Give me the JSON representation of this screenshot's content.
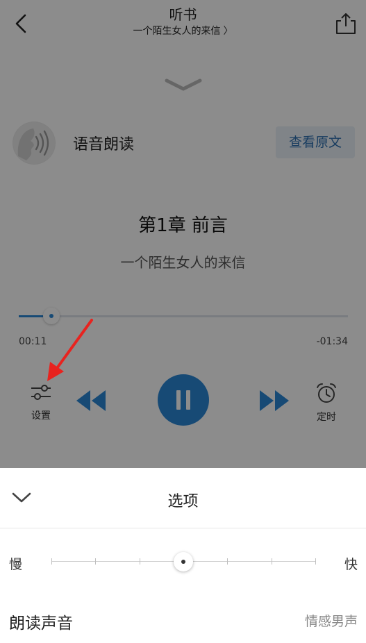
{
  "header": {
    "title": "听书",
    "subtitle": "一个陌生女人的来信",
    "subtitle_chevron": "〉",
    "back_icon": "chevron-left-icon",
    "share_icon": "share-upload-icon"
  },
  "player": {
    "mode_label": "语音朗读",
    "view_original_label": "查看原文",
    "chapter_title": "第1章 前言",
    "book_title": "一个陌生女人的来信",
    "progress": 0.1,
    "time_elapsed": "00:11",
    "time_remaining": "-01:34",
    "controls": {
      "settings_label": "设置",
      "timer_label": "定时",
      "play_state": "playing"
    }
  },
  "sheet": {
    "title": "选项",
    "speed_slow_label": "慢",
    "speed_fast_label": "快",
    "speed_steps": 7,
    "speed_value_index": 3,
    "voice_label": "朗读声音",
    "voice_value": "情感男声"
  },
  "colors": {
    "accent": "#2b87d6",
    "annotation": "#e8231f",
    "overlay": "rgba(0,0,0,0.45)"
  }
}
